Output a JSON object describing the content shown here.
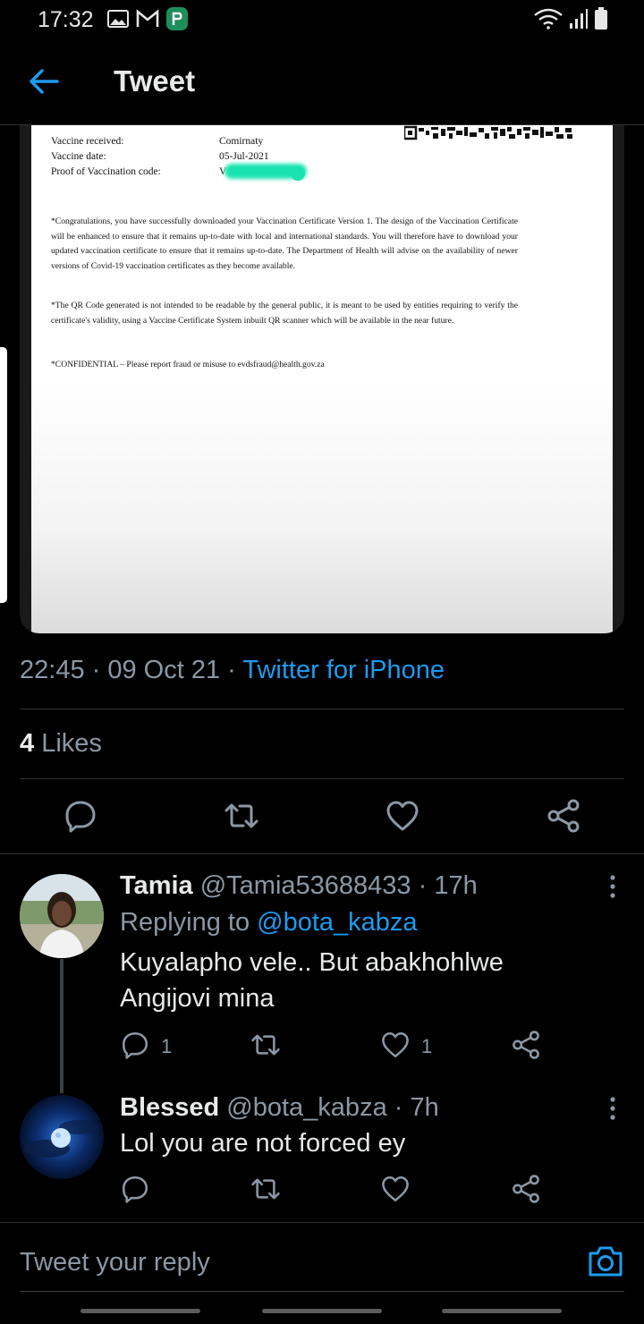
{
  "status_bar": {
    "time": "17:32",
    "icons": [
      "gallery-icon",
      "gmail-icon",
      "maps-icon",
      "wifi-icon",
      "signal-icon",
      "battery-icon"
    ]
  },
  "header": {
    "title": "Tweet",
    "back_icon": "back-arrow-icon"
  },
  "media": {
    "rows": [
      {
        "label": "Vaccine received:",
        "value": "Comirnaty"
      },
      {
        "label": "Vaccine date:",
        "value": "05-Jul-2021"
      },
      {
        "label": "Proof of Vaccination code:",
        "value": "V"
      }
    ],
    "paragraphs": [
      "*Congratulations, you have successfully downloaded your Vaccination Certificate Version 1. The design of the Vaccination Certificate will be enhanced to ensure that it remains up-to-date with local and international standards. You will therefore have to download your updated vaccination certificate to ensure that it remains up-to-date. The Department of Health will advise on the availability of newer versions of Covid-19 vaccination certificates as they become available.",
      "*The QR Code generated is not intended to be readable by the general public, it is meant to be used by entities requiring to verify the certificate's validity, using a Vaccine Certificate System inbuilt QR scanner which will be available in the near future.",
      "*CONFIDENTIAL – Please report fraud or misuse to evdsfraud@health.gov.za"
    ]
  },
  "tweet_meta": {
    "time": "22:45",
    "sep1": " · ",
    "date": "09 Oct 21",
    "sep2": " · ",
    "client": "Twitter for iPhone"
  },
  "likes": {
    "count": "4",
    "label": " Likes"
  },
  "actions": [
    "reply-icon",
    "retweet-icon",
    "like-icon",
    "share-icon"
  ],
  "replies": [
    {
      "name": "Tamia",
      "handle": "@Tamia53688433",
      "age": " · 17h",
      "replying_prefix": "Replying to ",
      "replying_to": "@bota_kabza",
      "text_line1": "Kuyalapho vele.. But abakhohlwe",
      "text_line2": "Angijovi mina",
      "reply_count": "1",
      "like_count": "1"
    },
    {
      "name": "Blessed",
      "handle": "@bota_kabza",
      "age": " · 7h",
      "text_line1": "Lol you are not forced ey"
    }
  ],
  "composer": {
    "placeholder": "Tweet your reply",
    "camera_icon": "camera-icon"
  },
  "colors": {
    "accent": "#1d9bf0",
    "muted": "#8b98a5",
    "background": "#000000"
  }
}
